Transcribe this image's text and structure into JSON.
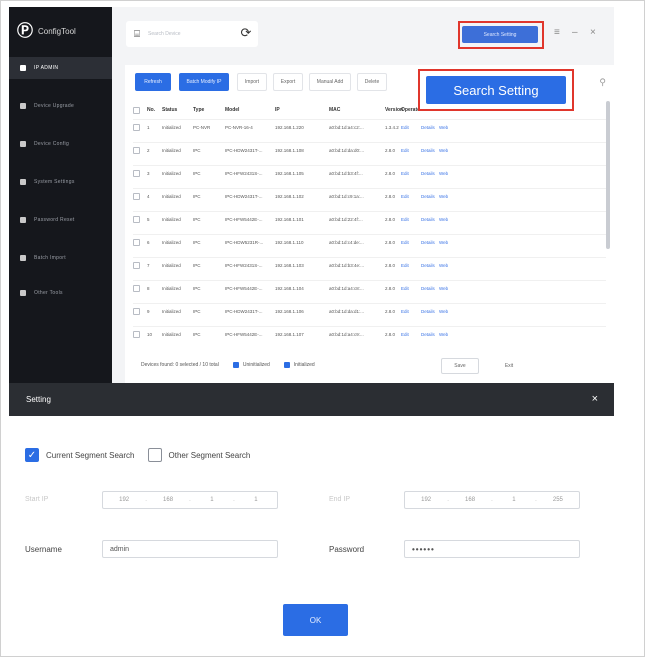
{
  "app": {
    "logo_text": "ConfigTool",
    "sidebar": {
      "items": [
        {
          "label": "IP ADMIN",
          "active": true
        },
        {
          "label": "Device Upgrade",
          "active": false
        },
        {
          "label": "Device Config",
          "active": false
        },
        {
          "label": "System Settings",
          "active": false
        },
        {
          "label": "Password Reset",
          "active": false
        },
        {
          "label": "Batch Import",
          "active": false
        },
        {
          "label": "Other Tools",
          "active": false
        }
      ]
    },
    "topbar": {
      "search_text": "Search Device",
      "search_setting_label": "Search Setting"
    },
    "toolbar": {
      "buttons": [
        "Refresh",
        "Batch Modify IP",
        "Import",
        "Export",
        "Manual Add",
        "Delete"
      ]
    },
    "table": {
      "columns": [
        "No.",
        "Status",
        "Type",
        "Model",
        "IP",
        "MAC",
        "Version",
        "Operate"
      ],
      "rows": [
        {
          "no": "1",
          "status": "Initialized",
          "type": "PC-NVR",
          "model": "PC-NVR-16-4",
          "ip": "192.168.1.220",
          "mac": "a0:bd:1d:a4:c2:...",
          "ver": "1.3.4.2"
        },
        {
          "no": "2",
          "status": "Initialized",
          "type": "IPC",
          "model": "IPC-HDW2431T-...",
          "ip": "192.168.1.108",
          "mac": "a0:bd:1d:da:d0:...",
          "ver": "2.8.0"
        },
        {
          "no": "3",
          "status": "Initialized",
          "type": "IPC",
          "model": "IPC-HFW2431S-...",
          "ip": "192.168.1.105",
          "mac": "a0:bd:1d:b3:4f:...",
          "ver": "2.8.0"
        },
        {
          "no": "4",
          "status": "Initialized",
          "type": "IPC",
          "model": "IPC-HDW2431T-...",
          "ip": "192.168.1.102",
          "mac": "a0:bd:1d:c9:1a:...",
          "ver": "2.8.0"
        },
        {
          "no": "5",
          "status": "Initialized",
          "type": "IPC",
          "model": "IPC-HFW5442E-...",
          "ip": "192.168.1.101",
          "mac": "a0:bd:1d:22:4f:...",
          "ver": "2.8.0"
        },
        {
          "no": "6",
          "status": "Initialized",
          "type": "IPC",
          "model": "IPC-HDW5231R-...",
          "ip": "192.168.1.110",
          "mac": "a0:bd:1d:c4:de:...",
          "ver": "2.8.0"
        },
        {
          "no": "7",
          "status": "Initialized",
          "type": "IPC",
          "model": "IPC-HFW2431S-...",
          "ip": "192.168.1.103",
          "mac": "a0:bd:1d:b3:4e:...",
          "ver": "2.8.0"
        },
        {
          "no": "8",
          "status": "Initialized",
          "type": "IPC",
          "model": "IPC-HFW5442E-...",
          "ip": "192.168.1.104",
          "mac": "a0:bd:1d:a4:c8:...",
          "ver": "2.8.0"
        },
        {
          "no": "9",
          "status": "Initialized",
          "type": "IPC",
          "model": "IPC-HDW2431T-...",
          "ip": "192.168.1.106",
          "mac": "a0:bd:1d:da:d1:...",
          "ver": "2.8.0"
        },
        {
          "no": "10",
          "status": "Initialized",
          "type": "IPC",
          "model": "IPC-HFW5442E-...",
          "ip": "192.168.1.107",
          "mac": "a0:bd:1d:a4:c9:...",
          "ver": "2.8.0"
        }
      ],
      "action_edit": "Edit",
      "action_details": "Details",
      "action_web": "Web"
    },
    "footer": {
      "selected_text": "Devices found: 0 selected / 10 total",
      "filter1": "Uninitialized",
      "filter2": "Initialized",
      "btn_a": "Save",
      "btn_b": "Exit"
    },
    "callout_label": "Search Setting"
  },
  "dialog": {
    "title": "Setting",
    "opt_current": "Current Segment Search",
    "opt_other": "Other Segment Search",
    "start_label": "Start IP",
    "end_label": "End IP",
    "start_ip": [
      "192",
      "168",
      "1",
      "1"
    ],
    "end_ip": [
      "192",
      "168",
      "1",
      "255"
    ],
    "username_label": "Username",
    "username_value": "admin",
    "password_label": "Password",
    "password_value": "••••••",
    "ok_label": "OK"
  }
}
